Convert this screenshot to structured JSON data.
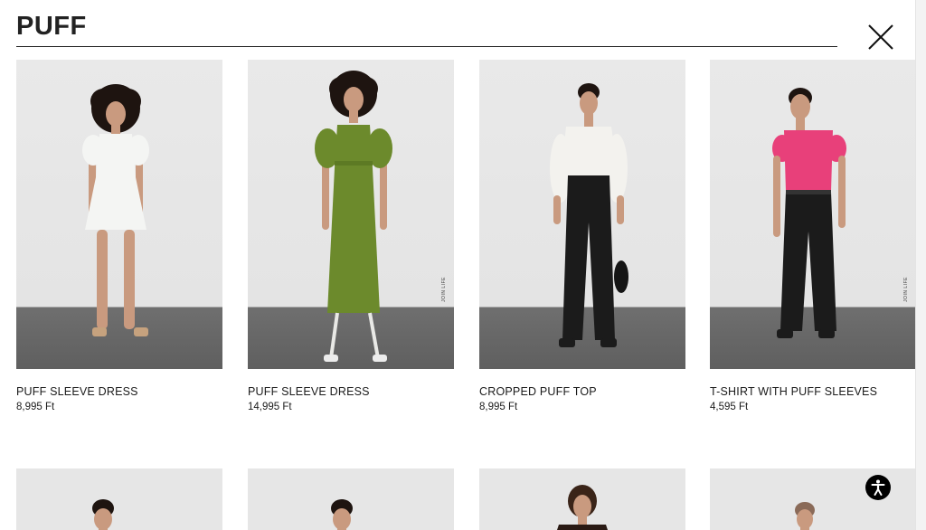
{
  "search": {
    "query": "PUFF"
  },
  "products": [
    {
      "title": "PUFF SLEEVE DRESS",
      "price": "8,995 Ft"
    },
    {
      "title": "PUFF SLEEVE DRESS",
      "price": "14,995 Ft"
    },
    {
      "title": "CROPPED PUFF TOP",
      "price": "8,995 Ft"
    },
    {
      "title": "T-SHIRT WITH PUFF SLEEVES",
      "price": "4,595 Ft"
    }
  ],
  "colors": {
    "dress_white": "#f4f5f3",
    "dress_green": "#6c8a2c",
    "top_white": "#f3f2ee",
    "tee_pink": "#e8407a",
    "pants_black": "#1b1b1b",
    "skin": "#c99a7f",
    "hair": "#1e1410"
  }
}
